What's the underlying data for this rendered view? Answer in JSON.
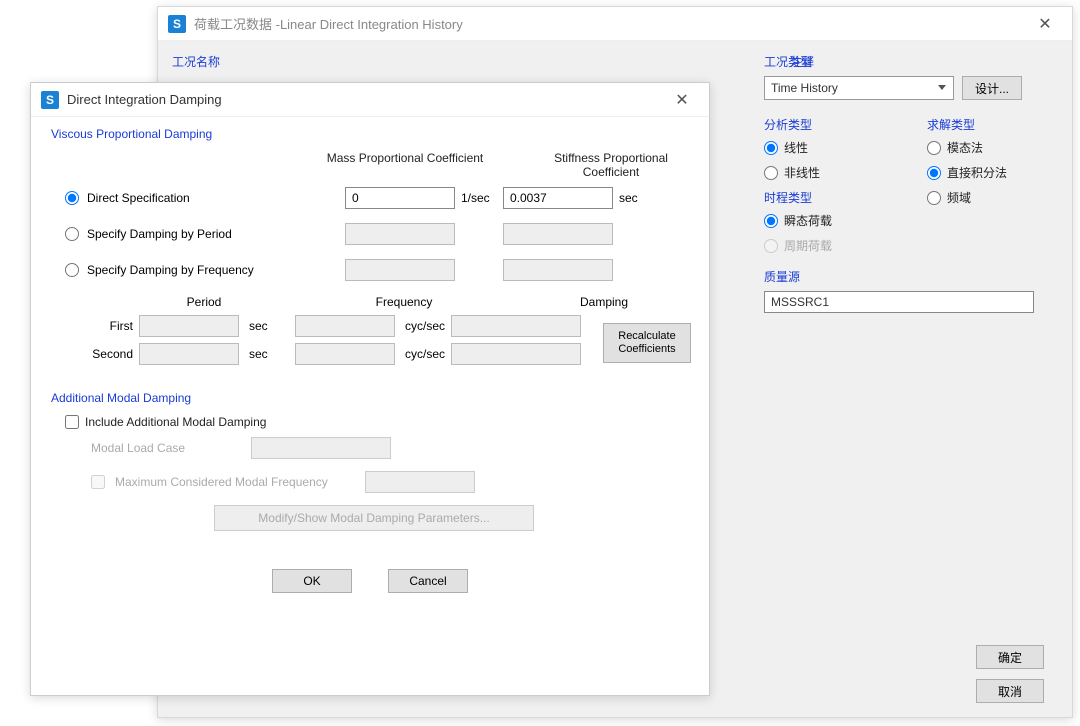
{
  "back": {
    "title": "荷载工况数据 -Linear Direct Integration History",
    "labels": {
      "case_name": "工况名称",
      "notes": "注释",
      "case_type": "工况类型",
      "case_type_value": "Time History",
      "design_btn": "设计...",
      "analysis_type": "分析类型",
      "solve_type": "求解类型",
      "history_type": "时程类型",
      "mass_source": "质量源"
    },
    "analysis": {
      "linear": "线性",
      "nonlinear": "非线性"
    },
    "solve": {
      "modal": "模态法",
      "direct": "直接积分法",
      "freq": "频域"
    },
    "hist": {
      "transient": "瞬态荷载",
      "periodic": "周期荷载"
    },
    "mass_source_value": "MSSSRC1",
    "buttons": {
      "ok": "确定",
      "cancel": "取消"
    }
  },
  "front": {
    "title": "Direct Integration Damping",
    "sections": {
      "vpd": "Viscous Proportional Damping",
      "amd": "Additional Modal Damping"
    },
    "headers": {
      "mass": "Mass Proportional Coefficient",
      "stiff": "Stiffness Proportional Coefficient"
    },
    "choices": {
      "direct": "Direct Specification",
      "by_period": "Specify Damping by Period",
      "by_freq": "Specify Damping by Frequency"
    },
    "values": {
      "mass_coef": "0",
      "stiff_coef": "0.0037"
    },
    "units": {
      "mass": "1/sec",
      "stiff": "sec"
    },
    "pf": {
      "period": "Period",
      "frequency": "Frequency",
      "damping": "Damping",
      "first": "First",
      "second": "Second",
      "sec": "sec",
      "cycsec": "cyc/sec"
    },
    "recalc": "Recalculate Coefficients",
    "amd": {
      "include": "Include Additional Modal Damping",
      "modal_case": "Modal Load Case",
      "max_freq": "Maximum Considered Modal Frequency",
      "modify_btn": "Modify/Show Modal Damping Parameters..."
    },
    "buttons": {
      "ok": "OK",
      "cancel": "Cancel"
    }
  }
}
